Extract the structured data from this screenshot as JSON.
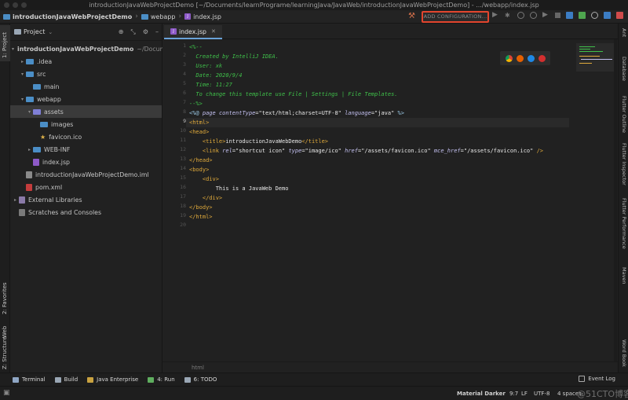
{
  "window": {
    "title": "introductionJavaWebProjectDemo [~/Documents/learnPrograme/learningJava/JavaWeb/introductionJavaWebProjectDemo] - .../webapp/index.jsp"
  },
  "navbar": {
    "breadcrumbs": [
      "introductionJavaWebProjectDemo",
      "webapp",
      "index.jsp"
    ],
    "add_configuration": "ADD CONFIGURATION..."
  },
  "left_stripe": {
    "project": "1: Project",
    "favorites": "2: Favorites",
    "web": "Web",
    "structure": "Z: Structure"
  },
  "right_stripe": [
    "Ant",
    "Database",
    "Flutter Outline",
    "Flutter Inspector",
    "Flutter Performance",
    "Maven",
    "Word Book"
  ],
  "project_panel": {
    "title": "Project",
    "tree": [
      {
        "label": "introductionJavaWebProjectDemo",
        "suffix": "~/Docum",
        "level": 0,
        "expanded": true,
        "icon": "folder-icon",
        "bold": true
      },
      {
        "label": ".idea",
        "level": 1,
        "expanded": false,
        "icon": "folder-icon"
      },
      {
        "label": "src",
        "level": 1,
        "expanded": true,
        "icon": "folder-icon"
      },
      {
        "label": "main",
        "level": 2,
        "expanded": null,
        "icon": "folder-icon"
      },
      {
        "label": "webapp",
        "level": 1,
        "expanded": true,
        "icon": "folder-icon"
      },
      {
        "label": "assets",
        "level": 2,
        "expanded": true,
        "icon": "folder-icon",
        "selected": true
      },
      {
        "label": "images",
        "level": 3,
        "expanded": null,
        "icon": "folder-icon"
      },
      {
        "label": "favicon.ico",
        "level": 3,
        "expanded": null,
        "icon": "star-icon"
      },
      {
        "label": "WEB-INF",
        "level": 2,
        "expanded": false,
        "icon": "folder-icon"
      },
      {
        "label": "index.jsp",
        "level": 2,
        "expanded": null,
        "icon": "jsp-file-icon"
      },
      {
        "label": "introductionJavaWebProjectDemo.iml",
        "level": 1,
        "expanded": null,
        "icon": "iml-file-icon"
      },
      {
        "label": "pom.xml",
        "level": 1,
        "expanded": null,
        "icon": "maven-file-icon"
      },
      {
        "label": "External Libraries",
        "level": 0,
        "expanded": false,
        "icon": "library-icon"
      },
      {
        "label": "Scratches and Consoles",
        "level": 0,
        "expanded": null,
        "icon": "scratch-icon"
      }
    ]
  },
  "editor": {
    "tab_label": "index.jsp",
    "current_line": 9,
    "line_numbers": [
      "1",
      "2",
      "3",
      "4",
      "5",
      "6",
      "7",
      "8",
      "9",
      "10",
      "11",
      "12",
      "13",
      "14",
      "15",
      "16",
      "17",
      "18",
      "19",
      "20"
    ],
    "lines": [
      [
        [
          "c-com",
          "<%--"
        ]
      ],
      [
        [
          "c-com",
          "  Created by IntelliJ IDEA."
        ]
      ],
      [
        [
          "c-com",
          "  User: xk"
        ]
      ],
      [
        [
          "c-com",
          "  Date: 2020/9/4"
        ]
      ],
      [
        [
          "c-com",
          "  Time: 11:27"
        ]
      ],
      [
        [
          "c-com",
          "  To change this template use File | Settings | File Templates."
        ]
      ],
      [
        [
          "c-com",
          "--%>"
        ]
      ],
      [
        [
          "c-pun",
          "<%@ "
        ],
        [
          "c-dir",
          "page "
        ],
        [
          "c-attr",
          "contentType"
        ],
        [
          "c-str",
          "=\"text/html;charset=UTF-8\" "
        ],
        [
          "c-attr",
          "language"
        ],
        [
          "c-str",
          "=\"java\" "
        ],
        [
          "c-pun",
          "%>"
        ]
      ],
      [
        [
          "c-tag",
          "<html>"
        ]
      ],
      [
        [
          "c-tag",
          "<head>"
        ]
      ],
      [
        [
          "c-tag",
          "    <title>"
        ],
        [
          "c-txt",
          "introductionJavaWebDemo"
        ],
        [
          "c-tag",
          "</title>"
        ]
      ],
      [
        [
          "c-tag",
          "    <link "
        ],
        [
          "c-attr",
          "rel"
        ],
        [
          "c-str",
          "=\"shortcut icon\" "
        ],
        [
          "c-attr",
          "type"
        ],
        [
          "c-str",
          "=\"image/ico\" "
        ],
        [
          "c-attr",
          "href"
        ],
        [
          "c-str",
          "=\"/assets/favicon.ico\" "
        ],
        [
          "c-attr",
          "mce_href"
        ],
        [
          "c-str",
          "=\"/assets/favicon.ico\" "
        ],
        [
          "c-tag",
          "/>"
        ]
      ],
      [
        [
          "c-tag",
          "</head>"
        ]
      ],
      [
        [
          "c-tag",
          "<body>"
        ]
      ],
      [
        [
          "c-tag",
          "    <div>"
        ]
      ],
      [
        [
          "c-txt",
          "        This is a JavaWeb Demo"
        ]
      ],
      [
        [
          "c-tag",
          "    </div>"
        ]
      ],
      [
        [
          "c-tag",
          "</body>"
        ]
      ],
      [
        [
          "c-tag",
          "</html>"
        ]
      ],
      []
    ],
    "breadcrumb": "html"
  },
  "bottom_tools": [
    {
      "label": "Terminal",
      "icon": "terminal-icon",
      "color": "#8fa6c4"
    },
    {
      "label": "Build",
      "icon": "build-icon",
      "color": "#9aa7b5"
    },
    {
      "label": "Java Enterprise",
      "icon": "java-enterprise-icon",
      "color": "#c9a240"
    },
    {
      "label": "4: Run",
      "icon": "run-icon",
      "color": "#5fae5f"
    },
    {
      "label": "6: TODO",
      "icon": "todo-icon",
      "color": "#9aa7b5"
    }
  ],
  "event_log": "Event Log",
  "status": {
    "theme": "Material Darker",
    "position": "9:7",
    "line_sep": "LF",
    "encoding": "UTF-8",
    "indent": "4 spaces",
    "watermark": "@51CTO博客"
  },
  "colors": {
    "accent": "#6aa2d8",
    "highlight_border": "#e2452e",
    "folder": "#4b8ec6",
    "comment": "#3fc04a",
    "tag": "#e0aa3b"
  }
}
